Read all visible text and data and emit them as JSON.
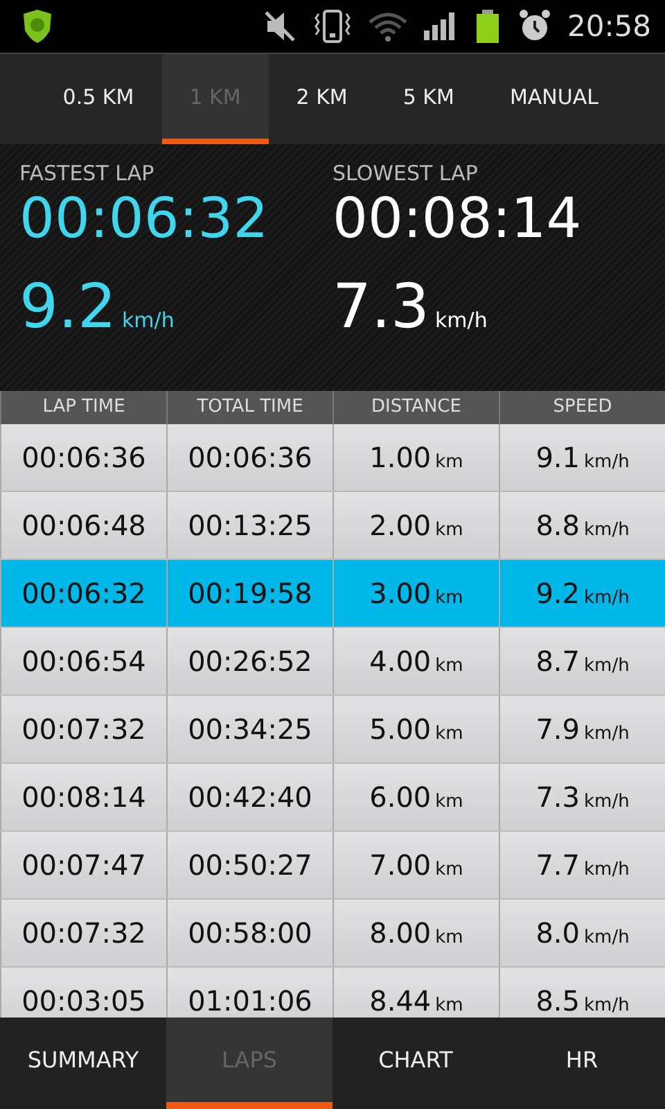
{
  "status_bar": {
    "time": "20:58"
  },
  "distance_tabs": [
    {
      "label": "0.5 KM",
      "selected": false
    },
    {
      "label": "1 KM",
      "selected": true
    },
    {
      "label": "2 KM",
      "selected": false
    },
    {
      "label": "5 KM",
      "selected": false
    },
    {
      "label": "MANUAL",
      "selected": false
    }
  ],
  "stats": [
    {
      "label": "FASTEST LAP",
      "time": "00:06:32",
      "speed": "9.2",
      "unit": "km/h",
      "highlight": true
    },
    {
      "label": "SLOWEST LAP",
      "time": "00:08:14",
      "speed": "7.3",
      "unit": "km/h",
      "highlight": false
    }
  ],
  "table": {
    "columns": [
      "LAP TIME",
      "TOTAL TIME",
      "DISTANCE",
      "SPEED"
    ],
    "rows": [
      {
        "lap_time": "00:06:36",
        "total_time": "00:06:36",
        "distance": "1.00",
        "distance_unit": "km",
        "speed": "9.1",
        "speed_unit": "km/h",
        "selected": false
      },
      {
        "lap_time": "00:06:48",
        "total_time": "00:13:25",
        "distance": "2.00",
        "distance_unit": "km",
        "speed": "8.8",
        "speed_unit": "km/h",
        "selected": false
      },
      {
        "lap_time": "00:06:32",
        "total_time": "00:19:58",
        "distance": "3.00",
        "distance_unit": "km",
        "speed": "9.2",
        "speed_unit": "km/h",
        "selected": true
      },
      {
        "lap_time": "00:06:54",
        "total_time": "00:26:52",
        "distance": "4.00",
        "distance_unit": "km",
        "speed": "8.7",
        "speed_unit": "km/h",
        "selected": false
      },
      {
        "lap_time": "00:07:32",
        "total_time": "00:34:25",
        "distance": "5.00",
        "distance_unit": "km",
        "speed": "7.9",
        "speed_unit": "km/h",
        "selected": false
      },
      {
        "lap_time": "00:08:14",
        "total_time": "00:42:40",
        "distance": "6.00",
        "distance_unit": "km",
        "speed": "7.3",
        "speed_unit": "km/h",
        "selected": false
      },
      {
        "lap_time": "00:07:47",
        "total_time": "00:50:27",
        "distance": "7.00",
        "distance_unit": "km",
        "speed": "7.7",
        "speed_unit": "km/h",
        "selected": false
      },
      {
        "lap_time": "00:07:32",
        "total_time": "00:58:00",
        "distance": "8.00",
        "distance_unit": "km",
        "speed": "8.0",
        "speed_unit": "km/h",
        "selected": false
      },
      {
        "lap_time": "00:03:05",
        "total_time": "01:01:06",
        "distance": "8.44",
        "distance_unit": "km",
        "speed": "8.5",
        "speed_unit": "km/h",
        "selected": false
      }
    ]
  },
  "bottom_tabs": [
    {
      "label": "SUMMARY",
      "selected": false
    },
    {
      "label": "LAPS",
      "selected": true
    },
    {
      "label": "CHART",
      "selected": false
    },
    {
      "label": "HR",
      "selected": false
    }
  ]
}
